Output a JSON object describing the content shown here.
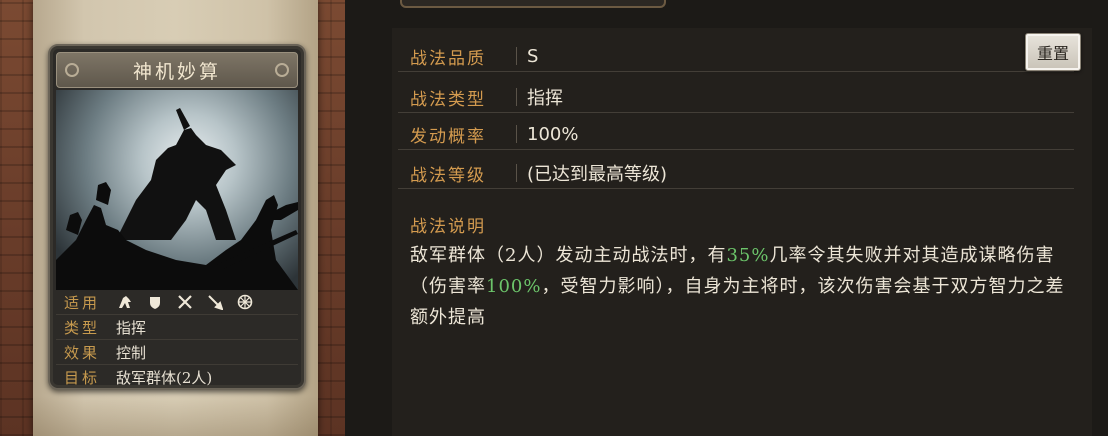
{
  "card": {
    "title": "神机妙算",
    "info": [
      {
        "key": "适用",
        "icons": [
          "cavalry-icon",
          "shield-icon",
          "crossed-swords-icon",
          "spear-icon",
          "wheel-icon"
        ]
      },
      {
        "key": "类型",
        "value": "指挥"
      },
      {
        "key": "效果",
        "value": "控制"
      },
      {
        "key": "目标",
        "value": "敌军群体(2人)"
      }
    ]
  },
  "attributes": [
    {
      "key": "战法品质",
      "value": "S"
    },
    {
      "key": "战法类型",
      "value": "指挥"
    },
    {
      "key": "发动概率",
      "value": "100%"
    },
    {
      "key": "战法等级",
      "value": "(已达到最高等级)"
    }
  ],
  "reset_button": "重置",
  "description": {
    "title": "战法说明",
    "parts": [
      {
        "text": "敌军群体（2人）发动主动战法时，有"
      },
      {
        "text": "35%",
        "highlight": true
      },
      {
        "text": "几率令其失败并对其造成谋略伤害（伤害率"
      },
      {
        "text": "100%",
        "highlight": true
      },
      {
        "text": "，受智力影响），自身为主将时，该次伤害会基于双方智力之差额外提高"
      }
    ]
  },
  "colors": {
    "label": "#d49b4f",
    "text": "#ece5d6",
    "highlight": "#6cc46a"
  }
}
